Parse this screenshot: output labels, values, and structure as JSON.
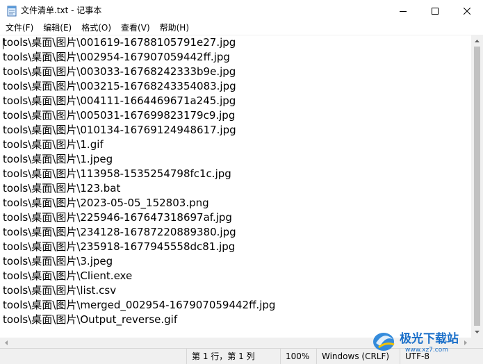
{
  "window": {
    "title": "文件清单.txt - 记事本"
  },
  "icons": {
    "app": "notepad-icon",
    "minimize": "minimize-icon",
    "maximize": "maximize-icon",
    "close": "close-icon"
  },
  "menu": [
    "文件(F)",
    "编辑(E)",
    "格式(O)",
    "查看(V)",
    "帮助(H)"
  ],
  "editor": {
    "lines": [
      "tools\\桌面\\图片\\001619-16788105791e27.jpg",
      "tools\\桌面\\图片\\002954-167907059442ff.jpg",
      "tools\\桌面\\图片\\003033-16768242333b9e.jpg",
      "tools\\桌面\\图片\\003215-16768243354083.jpg",
      "tools\\桌面\\图片\\004111-1664469671a245.jpg",
      "tools\\桌面\\图片\\005031-167699823179c9.jpg",
      "tools\\桌面\\图片\\010134-16769124948617.jpg",
      "tools\\桌面\\图片\\1.gif",
      "tools\\桌面\\图片\\1.jpeg",
      "tools\\桌面\\图片\\113958-1535254798fc1c.jpg",
      "tools\\桌面\\图片\\123.bat",
      "tools\\桌面\\图片\\2023-05-05_152803.png",
      "tools\\桌面\\图片\\225946-167647318697af.jpg",
      "tools\\桌面\\图片\\234128-16787220889380.jpg",
      "tools\\桌面\\图片\\235918-1677945558dc81.jpg",
      "tools\\桌面\\图片\\3.jpeg",
      "tools\\桌面\\图片\\Client.exe",
      "tools\\桌面\\图片\\list.csv",
      "tools\\桌面\\图片\\merged_002954-167907059442ff.jpg",
      "tools\\桌面\\图片\\Output_reverse.gif"
    ]
  },
  "status": {
    "position": "第 1 行，第 1 列",
    "zoom": "100%",
    "line_ending": "Windows (CRLF)",
    "encoding": "UTF-8"
  },
  "watermark": {
    "text": "极光下载站",
    "url": "www.xz7.com"
  }
}
